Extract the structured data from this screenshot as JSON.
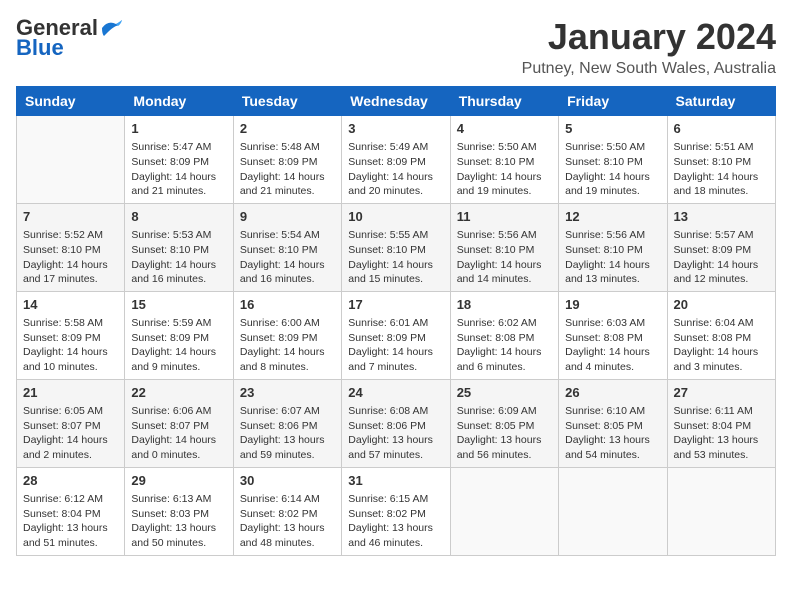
{
  "logo": {
    "general": "General",
    "blue": "Blue"
  },
  "title": "January 2024",
  "location": "Putney, New South Wales, Australia",
  "days_of_week": [
    "Sunday",
    "Monday",
    "Tuesday",
    "Wednesday",
    "Thursday",
    "Friday",
    "Saturday"
  ],
  "weeks": [
    [
      {
        "day": "",
        "info": ""
      },
      {
        "day": "1",
        "info": "Sunrise: 5:47 AM\nSunset: 8:09 PM\nDaylight: 14 hours\nand 21 minutes."
      },
      {
        "day": "2",
        "info": "Sunrise: 5:48 AM\nSunset: 8:09 PM\nDaylight: 14 hours\nand 21 minutes."
      },
      {
        "day": "3",
        "info": "Sunrise: 5:49 AM\nSunset: 8:09 PM\nDaylight: 14 hours\nand 20 minutes."
      },
      {
        "day": "4",
        "info": "Sunrise: 5:50 AM\nSunset: 8:10 PM\nDaylight: 14 hours\nand 19 minutes."
      },
      {
        "day": "5",
        "info": "Sunrise: 5:50 AM\nSunset: 8:10 PM\nDaylight: 14 hours\nand 19 minutes."
      },
      {
        "day": "6",
        "info": "Sunrise: 5:51 AM\nSunset: 8:10 PM\nDaylight: 14 hours\nand 18 minutes."
      }
    ],
    [
      {
        "day": "7",
        "info": "Sunrise: 5:52 AM\nSunset: 8:10 PM\nDaylight: 14 hours\nand 17 minutes."
      },
      {
        "day": "8",
        "info": "Sunrise: 5:53 AM\nSunset: 8:10 PM\nDaylight: 14 hours\nand 16 minutes."
      },
      {
        "day": "9",
        "info": "Sunrise: 5:54 AM\nSunset: 8:10 PM\nDaylight: 14 hours\nand 16 minutes."
      },
      {
        "day": "10",
        "info": "Sunrise: 5:55 AM\nSunset: 8:10 PM\nDaylight: 14 hours\nand 15 minutes."
      },
      {
        "day": "11",
        "info": "Sunrise: 5:56 AM\nSunset: 8:10 PM\nDaylight: 14 hours\nand 14 minutes."
      },
      {
        "day": "12",
        "info": "Sunrise: 5:56 AM\nSunset: 8:10 PM\nDaylight: 14 hours\nand 13 minutes."
      },
      {
        "day": "13",
        "info": "Sunrise: 5:57 AM\nSunset: 8:09 PM\nDaylight: 14 hours\nand 12 minutes."
      }
    ],
    [
      {
        "day": "14",
        "info": "Sunrise: 5:58 AM\nSunset: 8:09 PM\nDaylight: 14 hours\nand 10 minutes."
      },
      {
        "day": "15",
        "info": "Sunrise: 5:59 AM\nSunset: 8:09 PM\nDaylight: 14 hours\nand 9 minutes."
      },
      {
        "day": "16",
        "info": "Sunrise: 6:00 AM\nSunset: 8:09 PM\nDaylight: 14 hours\nand 8 minutes."
      },
      {
        "day": "17",
        "info": "Sunrise: 6:01 AM\nSunset: 8:09 PM\nDaylight: 14 hours\nand 7 minutes."
      },
      {
        "day": "18",
        "info": "Sunrise: 6:02 AM\nSunset: 8:08 PM\nDaylight: 14 hours\nand 6 minutes."
      },
      {
        "day": "19",
        "info": "Sunrise: 6:03 AM\nSunset: 8:08 PM\nDaylight: 14 hours\nand 4 minutes."
      },
      {
        "day": "20",
        "info": "Sunrise: 6:04 AM\nSunset: 8:08 PM\nDaylight: 14 hours\nand 3 minutes."
      }
    ],
    [
      {
        "day": "21",
        "info": "Sunrise: 6:05 AM\nSunset: 8:07 PM\nDaylight: 14 hours\nand 2 minutes."
      },
      {
        "day": "22",
        "info": "Sunrise: 6:06 AM\nSunset: 8:07 PM\nDaylight: 14 hours\nand 0 minutes."
      },
      {
        "day": "23",
        "info": "Sunrise: 6:07 AM\nSunset: 8:06 PM\nDaylight: 13 hours\nand 59 minutes."
      },
      {
        "day": "24",
        "info": "Sunrise: 6:08 AM\nSunset: 8:06 PM\nDaylight: 13 hours\nand 57 minutes."
      },
      {
        "day": "25",
        "info": "Sunrise: 6:09 AM\nSunset: 8:05 PM\nDaylight: 13 hours\nand 56 minutes."
      },
      {
        "day": "26",
        "info": "Sunrise: 6:10 AM\nSunset: 8:05 PM\nDaylight: 13 hours\nand 54 minutes."
      },
      {
        "day": "27",
        "info": "Sunrise: 6:11 AM\nSunset: 8:04 PM\nDaylight: 13 hours\nand 53 minutes."
      }
    ],
    [
      {
        "day": "28",
        "info": "Sunrise: 6:12 AM\nSunset: 8:04 PM\nDaylight: 13 hours\nand 51 minutes."
      },
      {
        "day": "29",
        "info": "Sunrise: 6:13 AM\nSunset: 8:03 PM\nDaylight: 13 hours\nand 50 minutes."
      },
      {
        "day": "30",
        "info": "Sunrise: 6:14 AM\nSunset: 8:02 PM\nDaylight: 13 hours\nand 48 minutes."
      },
      {
        "day": "31",
        "info": "Sunrise: 6:15 AM\nSunset: 8:02 PM\nDaylight: 13 hours\nand 46 minutes."
      },
      {
        "day": "",
        "info": ""
      },
      {
        "day": "",
        "info": ""
      },
      {
        "day": "",
        "info": ""
      }
    ]
  ]
}
